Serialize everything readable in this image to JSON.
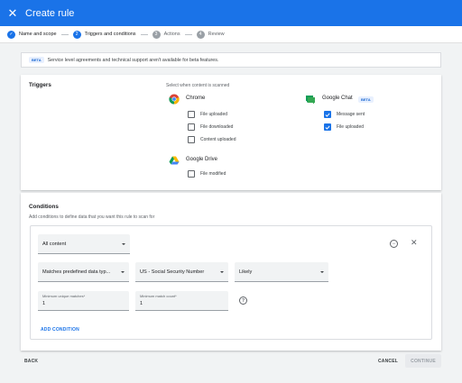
{
  "header": {
    "title": "Create rule",
    "close_icon": "close-icon"
  },
  "stepper": {
    "steps": [
      {
        "number": "✓",
        "label": "Name and scope",
        "state": "done"
      },
      {
        "number": "2",
        "label": "Triggers and conditions",
        "state": "current"
      },
      {
        "number": "3",
        "label": "Actions",
        "state": "todo"
      },
      {
        "number": "4",
        "label": "Review",
        "state": "todo"
      }
    ]
  },
  "banner": {
    "chip": "BETA",
    "text": "Service level agreements and technical support aren't available for beta features."
  },
  "triggers": {
    "title": "Triggers",
    "hint": "Select when content is scanned",
    "chrome": {
      "name": "Chrome",
      "options": [
        {
          "label": "File uploaded",
          "checked": false
        },
        {
          "label": "File downloaded",
          "checked": false
        },
        {
          "label": "Content uploaded",
          "checked": false
        }
      ]
    },
    "drive": {
      "name": "Google Drive",
      "options": [
        {
          "label": "File modified",
          "checked": false
        }
      ]
    },
    "chat": {
      "name": "Google Chat",
      "badge": "BETA",
      "options": [
        {
          "label": "Message sent",
          "checked": true
        },
        {
          "label": "File uploaded",
          "checked": true
        }
      ]
    }
  },
  "conditions": {
    "title": "Conditions",
    "description": "Add conditions to define data that you want this rule to scan for",
    "content_select": "All content",
    "match_type_select": "Matches predefined data typ...",
    "data_type_select": "US - Social Security Number",
    "likelihood_select": "Likely",
    "min_unique": {
      "label": "Minimum unique matches*",
      "value": "1"
    },
    "min_count": {
      "label": "Minimum match count*",
      "value": "1"
    },
    "add_condition": "ADD CONDITION"
  },
  "footer": {
    "back": "BACK",
    "cancel": "CANCEL",
    "continue": "CONTINUE"
  },
  "colors": {
    "accent": "#1a73e8",
    "background": "#f1f3f4"
  }
}
